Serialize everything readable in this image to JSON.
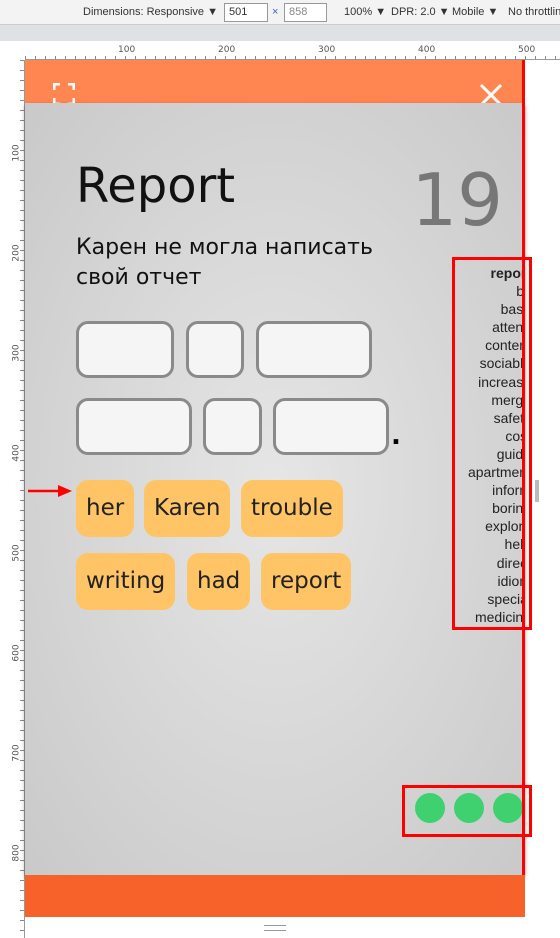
{
  "devtools": {
    "dimensions": "Dimensions: Responsive ▼",
    "width": "501",
    "height": "858",
    "zoom": "100% ▼",
    "dpr": "DPR: 2.0 ▼",
    "device": "Mobile ▼",
    "throttle": "No throttling",
    "ruler_h": [
      "100",
      "200",
      "300",
      "400",
      "500"
    ],
    "ruler_v": [
      "100",
      "200",
      "300",
      "400",
      "500",
      "600",
      "700",
      "800"
    ]
  },
  "app": {
    "title": "Report",
    "counter": "19",
    "prompt": "Карен не могла написать свой отчет",
    "period": ".",
    "chips": [
      "her",
      "Karen",
      "trouble",
      "writing",
      "had",
      "report"
    ],
    "words": [
      "report",
      "bit",
      "base",
      "attend",
      "content",
      "sociable",
      "increase",
      "merge",
      "safety",
      "cost",
      "guide",
      "apartment",
      "inform",
      "boring",
      "explore",
      "help",
      "direct",
      "idiom",
      "special",
      "medicine"
    ],
    "colors": {
      "header": "#ff8650",
      "footer": "#f6622a",
      "chip": "#ffc466",
      "dot": "#3fd170"
    }
  }
}
